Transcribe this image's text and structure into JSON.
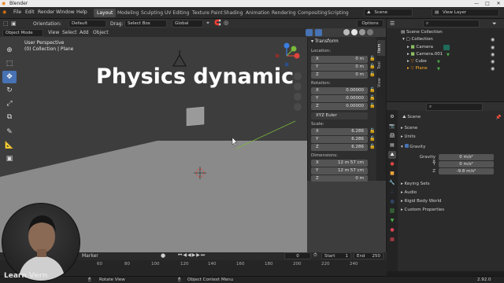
{
  "window": {
    "title": "Blender",
    "controls": [
      "—",
      "□",
      "✕"
    ]
  },
  "menu": {
    "items": [
      "File",
      "Edit",
      "Render",
      "Window",
      "Help"
    ],
    "workspaces": [
      "Layout",
      "Modeling",
      "Sculpting",
      "UV Editing",
      "Texture Paint",
      "Shading",
      "Animation",
      "Rendering",
      "Compositing",
      "Scripting"
    ],
    "active_workspace": "Layout",
    "scene_label": "Scene",
    "view_layer_label": "View Layer"
  },
  "viewport_header": {
    "orientation_label": "Orientation:",
    "orientation_value": "Default",
    "drag_label": "Drag:",
    "drag_value": "Select Box",
    "transform_space": "Global",
    "options_label": "Options",
    "mode": "Object Mode",
    "menus": [
      "View",
      "Select",
      "Add",
      "Object"
    ]
  },
  "viewport": {
    "view_name": "User Perspective",
    "collection_info": "(0) Collection | Plane",
    "overlay_title": "Physics dynamic"
  },
  "toolbar": {
    "tools": [
      "cursor-tool",
      "select-box-tool",
      "move-tool",
      "rotate-tool",
      "scale-tool",
      "transform-tool",
      "annotate-tool",
      "measure-tool",
      "add-cube-tool"
    ],
    "active_index": 2
  },
  "npanel": {
    "header": "Transform",
    "tabs": [
      "Item",
      "Tool",
      "View"
    ],
    "location_label": "Location:",
    "location": [
      {
        "axis": "X",
        "value": "0 m"
      },
      {
        "axis": "Y",
        "value": "0 m"
      },
      {
        "axis": "Z",
        "value": "0 m"
      }
    ],
    "rotation_label": "Rotation:",
    "rotation": [
      {
        "axis": "X",
        "value": "0.00000"
      },
      {
        "axis": "Y",
        "value": "0.00000"
      },
      {
        "axis": "Z",
        "value": "0.00000"
      }
    ],
    "rotation_mode": "XYZ Euler",
    "scale_label": "Scale:",
    "scale": [
      {
        "axis": "X",
        "value": "6.286"
      },
      {
        "axis": "Y",
        "value": "6.286"
      },
      {
        "axis": "Z",
        "value": "6.286"
      }
    ],
    "dimensions_label": "Dimensions:",
    "dimensions": [
      {
        "axis": "X",
        "value": "12 m 57 cm"
      },
      {
        "axis": "Y",
        "value": "12 m 57 cm"
      },
      {
        "axis": "Z",
        "value": "0 m"
      }
    ]
  },
  "outliner": {
    "root": "Scene Collection",
    "collection": "Collection",
    "objects": [
      "Camera",
      "Camera.001",
      "Cube",
      "Plane"
    ]
  },
  "properties": {
    "scene_name": "Scene",
    "sections_top": [
      "Scene",
      "Units"
    ],
    "gravity_section": "Gravity",
    "gravity": [
      {
        "axis": "Gravity X",
        "value": "0 m/s²"
      },
      {
        "axis": "Y",
        "value": "0 m/s²"
      },
      {
        "axis": "Z",
        "value": "-9.8 m/s²"
      }
    ],
    "sections_bottom": [
      "Keying Sets",
      "Audio",
      "Rigid Body World",
      "Custom Properties"
    ]
  },
  "timeline": {
    "menu": [
      "Marker"
    ],
    "current_frame": "0",
    "start_label": "Start",
    "start_value": "1",
    "end_label": "End",
    "end_value": "250",
    "ticks": [
      "60",
      "80",
      "100",
      "120",
      "140",
      "160",
      "180",
      "200",
      "220",
      "240"
    ]
  },
  "statusbar": {
    "rotate_view": "Rotate View",
    "context_menu": "Object Context Menu",
    "version": "2.92.0"
  },
  "watermark": "Learn Vern",
  "colors": {
    "accent": "#4772b3",
    "viewport_bg": "#3d3d3d",
    "floor": "#8a8a8a",
    "axis_x": "#e0443c",
    "axis_y": "#7bb83c",
    "axis_z": "#3b7de0"
  }
}
